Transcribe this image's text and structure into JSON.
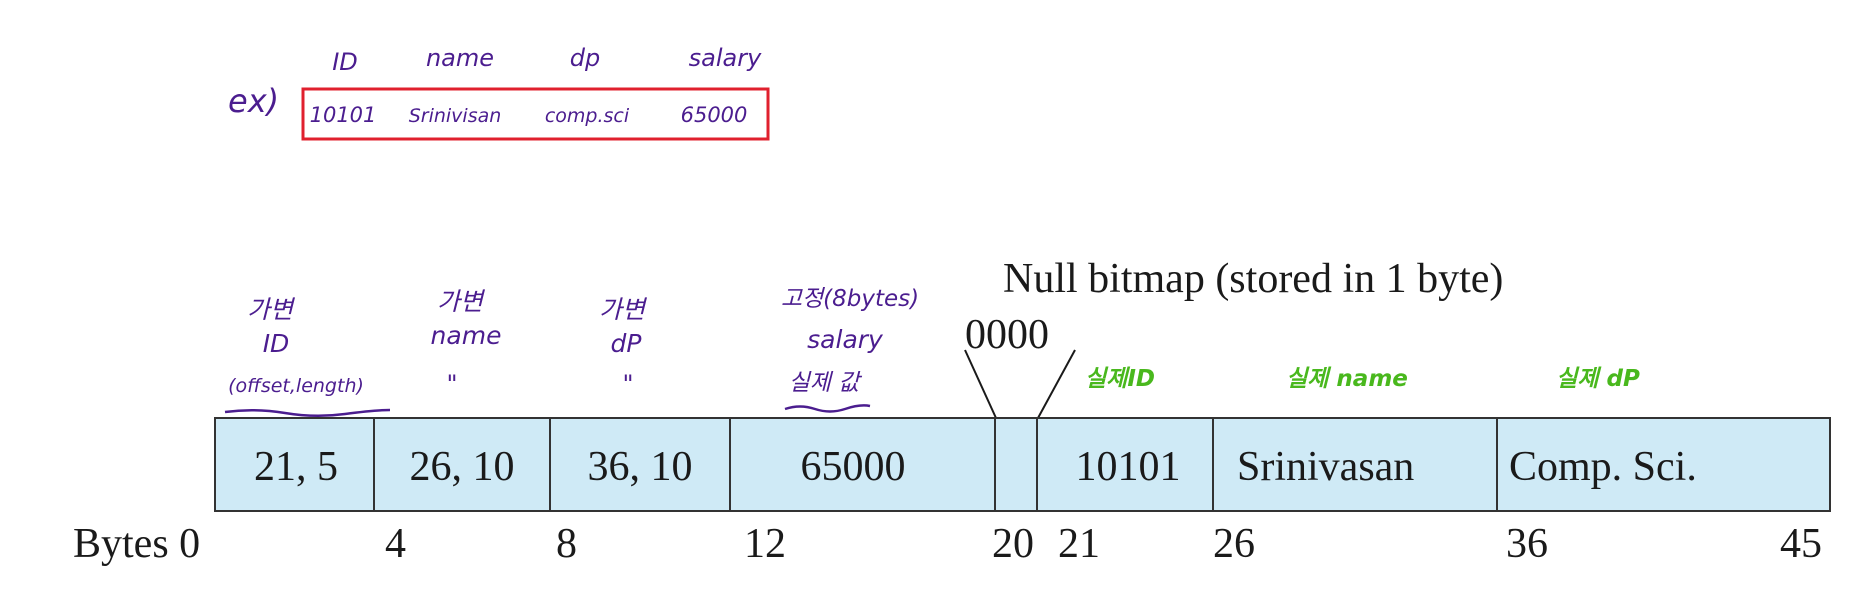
{
  "example": {
    "prefix": "ex)",
    "headers": [
      "ID",
      "name",
      "dp",
      "salary"
    ],
    "values": [
      "10101",
      "Srinivisan",
      "comp.sci",
      "65000"
    ],
    "box_color": "#e0202e"
  },
  "annotations": {
    "id": [
      "가변",
      "ID",
      "(offset,length)"
    ],
    "name": [
      "가변",
      "name",
      "\""
    ],
    "dp": [
      "가변",
      "dP",
      "\""
    ],
    "salary": [
      "고정(8bytes)",
      "salary",
      "실제 값"
    ],
    "actual_id": "실제ID",
    "actual_name": "실제 name",
    "actual_dp": "실제 dP"
  },
  "record": {
    "cells": [
      "21, 5",
      "26, 10",
      "36, 10",
      "65000",
      "",
      "10101",
      "Srinivasan",
      "Comp. Sci."
    ],
    "null_bitmap_label": "Null bitmap (stored in 1 byte)",
    "null_bitmap_value": "0000",
    "byte_label": "Bytes 0",
    "offsets": [
      "4",
      "8",
      "12",
      "20",
      "21",
      "26",
      "36",
      "45"
    ]
  },
  "colors": {
    "cell_fill": "#cfeaf6",
    "handwriting": "#4b1d8f",
    "handwriting_green": "#49b81d"
  }
}
